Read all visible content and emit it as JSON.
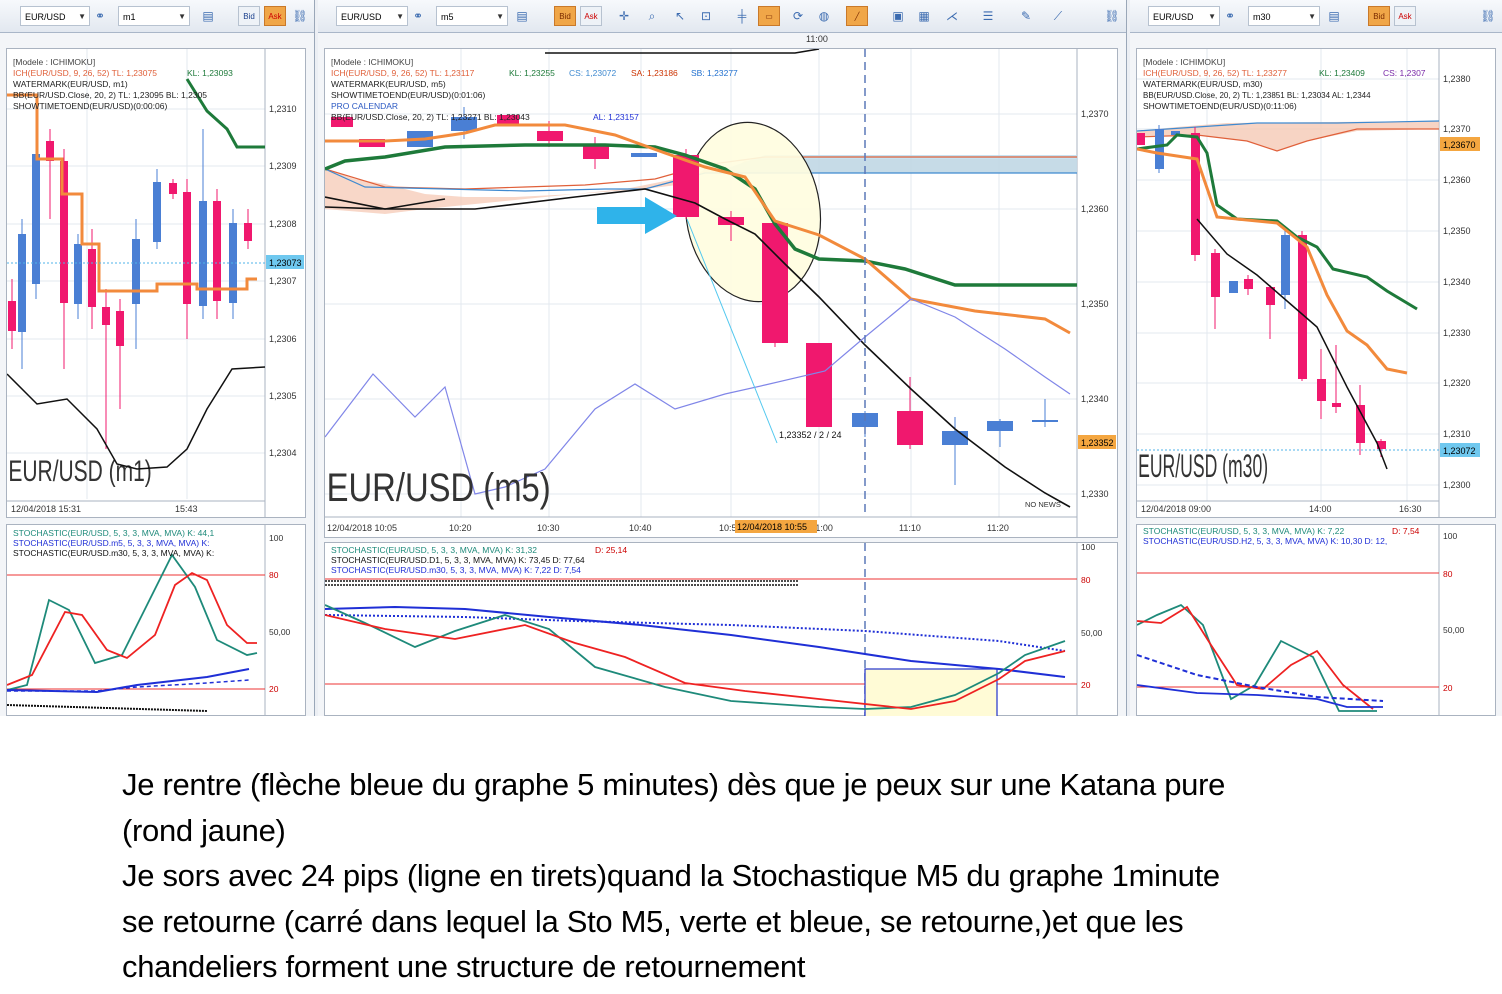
{
  "panels": {
    "m1": {
      "symbol": "EUR/USD",
      "timeframe": "m1",
      "info": [
        "[Modele : ICHIMOKU]",
        "ICH(EUR/USD, 9, 26, 52)  TL: 1,23075",
        "KL: 1,23093",
        "WATERMARK(EUR/USD, m1)",
        "BB(EUR/USD.Close, 20, 2)  TL: 1,23095  BL: 1,2305",
        "SHOWTIMETOEND(EUR/USD)(0:00:06)"
      ],
      "yticks": [
        "1,2310",
        "1,2309",
        "1,2308",
        "1,2307",
        "1,2306",
        "1,2305",
        "1,2304"
      ],
      "price_tag": "1,23073",
      "watermark": "EUR/USD (m1)",
      "xticks": [
        "12/04/2018 15:31",
        "15:43"
      ],
      "stoch_info": [
        "STOCHASTIC(EUR/USD, 5, 3, 3, MVA, MVA)  K: 44,1",
        "STOCHASTIC(EUR/USD.m5, 5, 3, 3, MVA, MVA)  K:",
        "STOCHASTIC(EUR/USD.m30, 5, 3, 3, MVA, MVA)  K:"
      ],
      "stoch_ticks": [
        "100",
        "80",
        "50,00",
        "20"
      ]
    },
    "m5": {
      "symbol": "EUR/USD",
      "timeframe": "m5",
      "time_marker": "11:00",
      "info": [
        "[Modele : ICHIMOKU]",
        "ICH(EUR/USD, 9, 26, 52)  TL: 1,23117",
        "KL: 1,23255",
        "CS: 1,23072",
        "SA: 1,23186",
        "SB: 1,23277",
        "WATERMARK(EUR/USD, m5)",
        "SHOWTIMETOEND(EUR/USD)(0:01:06)",
        "PRO CALENDAR",
        "BB(EUR/USD.Close, 20, 2)  TL: 1,23271  BL: 1,23043",
        "AL: 1,23157"
      ],
      "yticks": [
        "1,2370",
        "1,2360",
        "1,2350",
        "1,2340",
        "1,2330"
      ],
      "price_tag": "1,23352",
      "annotation": "1,23352 / 2 / 24",
      "watermark": "EUR/USD (m5)",
      "no_news": "NO NEWS",
      "xticks": [
        "12/04/2018 10:05",
        "10:20",
        "10:30",
        "10:40",
        "10:5",
        "11:00",
        "11:10",
        "11:20"
      ],
      "cursor_time": "12/04/2018 10:55",
      "stoch_info": [
        "STOCHASTIC(EUR/USD, 5, 3, 3, MVA, MVA)  K: 31,32",
        "D: 25,14",
        "STOCHASTIC(EUR/USD.D1, 5, 3, 3, MVA, MVA)  K: 73,45  D: 77,64",
        "STOCHASTIC(EUR/USD.m30, 5, 3, 3, MVA, MVA)  K: 7,22  D: 7,54"
      ],
      "stoch_ticks": [
        "100",
        "80",
        "50,00",
        "20"
      ]
    },
    "m30": {
      "symbol": "EUR/USD",
      "timeframe": "m30",
      "info": [
        "[Modele : ICHIMOKU]",
        "ICH(EUR/USD, 9, 26, 52)  TL: 1,23277",
        "KL: 1,23409",
        "CS: 1,2307",
        "WATERMARK(EUR/USD, m30)",
        "BB(EUR/USD.Close, 20, 2)  TL: 1,23851  BL: 1,23034  AL: 1,2344",
        "SHOWTIMETOEND(EUR/USD)(0:11:06)"
      ],
      "yticks": [
        "1,2380",
        "1,2370",
        "1,2360",
        "1,2350",
        "1,2340",
        "1,2330",
        "1,2320",
        "1,2310",
        "1,2300"
      ],
      "price_tag_top": "1,23670",
      "price_tag": "1,23072",
      "watermark": "EUR/USD (m30)",
      "xticks": [
        "12/04/2018 09:00",
        "14:00",
        "16:30"
      ],
      "stoch_info": [
        "STOCHASTIC(EUR/USD, 5, 3, 3, MVA, MVA)  K: 7,22",
        "D: 7,54",
        "STOCHASTIC(EUR/USD.H2, 5, 3, 3, MVA, MVA)  K: 10,30  D: 12,"
      ],
      "stoch_ticks": [
        "100",
        "80",
        "50,00",
        "20"
      ]
    }
  },
  "toolbar": {
    "bid": "Bid",
    "ask": "Ask"
  },
  "colors": {
    "bull": "#4a7fd4",
    "bear": "#f0186e",
    "kijun": "#1e7a3a",
    "tenkan": "#f28a3c",
    "cloud": "#f5c9b5",
    "cloud_blue": "#b9dcef",
    "price_tag": "#6fc8ef",
    "price_tag_orange": "#f4a640"
  },
  "caption": [
    "Je rentre  (flèche bleue du graphe 5 minutes) dès que je peux sur une Katana pure",
    "(rond jaune)",
    "Je sors avec 24 pips (ligne en tirets)quand la Stochastique M5 du graphe 1minute",
    "se retourne (carré dans lequel la Sto M5, verte et bleue, se retourne,)et que les",
    "chandeliers forment une structure de retournement"
  ]
}
